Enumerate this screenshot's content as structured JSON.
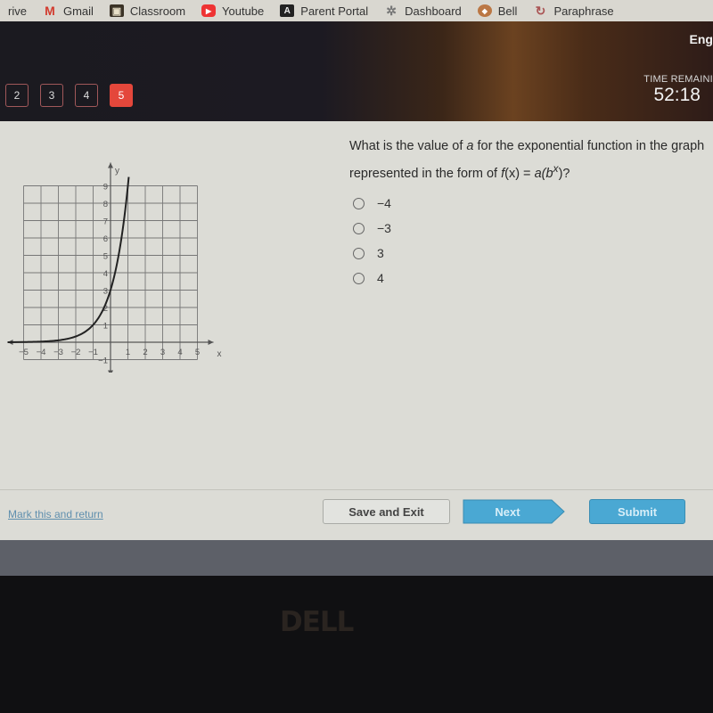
{
  "bookmarks": [
    {
      "label": "rive",
      "icon": "drive-icon"
    },
    {
      "label": "Gmail",
      "icon": "gmail-icon"
    },
    {
      "label": "Classroom",
      "icon": "classroom-icon"
    },
    {
      "label": "Youtube",
      "icon": "youtube-icon"
    },
    {
      "label": "Parent Portal",
      "icon": "parent-portal-icon"
    },
    {
      "label": "Dashboard",
      "icon": "dashboard-icon"
    },
    {
      "label": "Bell",
      "icon": "bell-icon"
    },
    {
      "label": "Paraphrase",
      "icon": "paraphrase-icon"
    }
  ],
  "header": {
    "language": "Eng",
    "question_nav": [
      {
        "label": "2",
        "active": false
      },
      {
        "label": "3",
        "active": false
      },
      {
        "label": "4",
        "active": false
      },
      {
        "label": "5",
        "active": true
      }
    ],
    "timer_label": "TIME REMAININ",
    "timer_value": "52:18"
  },
  "question": {
    "text_part1": "What is the value of ",
    "var_a": "a",
    "text_part2": " for the exponential function in the graph represented in the form of ",
    "formula_f": "f",
    "formula_x": "(x)",
    "formula_eq": " = ",
    "formula_a": "a",
    "formula_b": "(b",
    "formula_exp": "x",
    "formula_end": ")?",
    "options": [
      "−4",
      "−3",
      "3",
      "4"
    ]
  },
  "footer": {
    "mark_link": "Mark this and return",
    "save_button": "Save and Exit",
    "next_button": "Next",
    "submit_button": "Submit"
  },
  "colors": {
    "active_question": "#e4473b",
    "primary_button": "#4aa8d3",
    "link": "#5f8fae"
  },
  "bezel_logo": "DELL",
  "chart_data": {
    "type": "line",
    "title": "",
    "xlabel": "x",
    "ylabel": "y",
    "xlim": [
      -5,
      5
    ],
    "ylim": [
      -1,
      9
    ],
    "grid": true,
    "x_ticks": [
      "-5",
      "-4",
      "-3",
      "-2",
      "-1",
      "1",
      "2",
      "3",
      "4",
      "5"
    ],
    "y_ticks": [
      "-1",
      "1",
      "2",
      "3",
      "4",
      "5",
      "6",
      "7",
      "8",
      "9"
    ],
    "series": [
      {
        "name": "f(x)",
        "x": [
          -5,
          -4,
          -3,
          -2,
          -1,
          0,
          0.5,
          1
        ],
        "y": [
          0.012,
          0.037,
          0.11,
          0.33,
          1,
          3,
          5.2,
          9
        ]
      }
    ]
  }
}
